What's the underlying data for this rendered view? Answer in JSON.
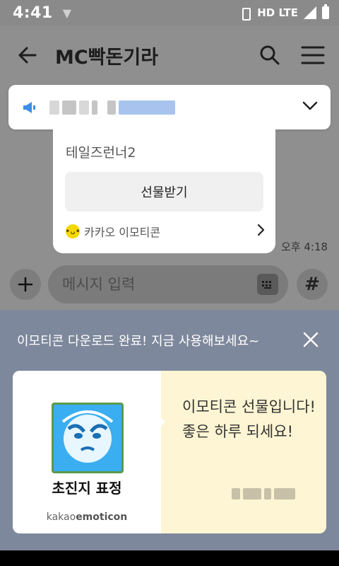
{
  "status_bar": {
    "time": "4:41",
    "network": "HD LTE"
  },
  "header": {
    "title": "MC빡돈기라"
  },
  "gift_message": {
    "item_name": "테일즈런너2",
    "receive_button_label": "선물받기",
    "footer_label": "카카오 이모티콘",
    "time": "오후 4:18"
  },
  "composer": {
    "placeholder": "메시지 입력",
    "hash_label": "#"
  },
  "popup": {
    "header": "이모티콘 다운로드 완료! 지금 사용해보세요~",
    "emoticon_title": "초진지 표정",
    "brand_prefix": "kakao",
    "brand_suffix": "emoticon",
    "message": "이모티콘 선물입니다! 좋은 하루 되세요!"
  },
  "colors": {
    "popup_background": "#7e889c",
    "card_right_background": "#fdf5d3",
    "kakao_yellow": "#f5d800"
  }
}
